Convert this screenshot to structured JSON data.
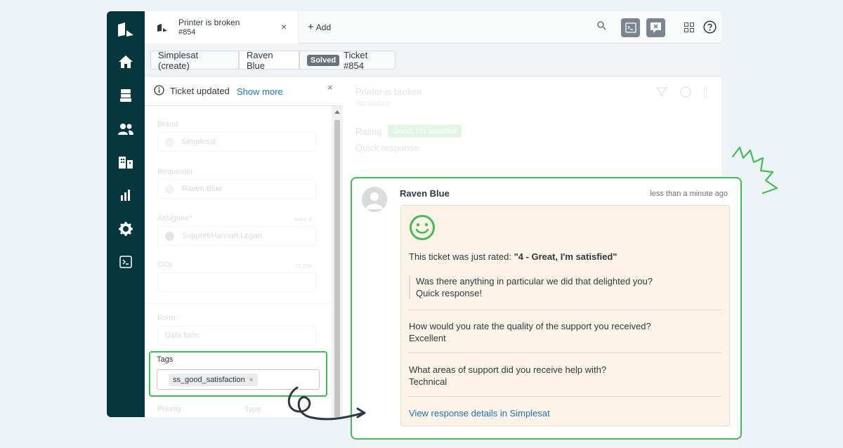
{
  "colors": {
    "nav_bg": "#03363d",
    "highlight_green": "#44bb55",
    "link_blue": "#1f73b7",
    "card_bg": "#fdf3e6",
    "solved_badge": "#68737d"
  },
  "nav": {
    "items": [
      "logo-icon",
      "home-icon",
      "views-icon",
      "customers-icon",
      "organizations-icon",
      "reporting-icon",
      "admin-gear-icon",
      "console-icon"
    ]
  },
  "topbar": {
    "tab_title": "Printer is broken",
    "tab_sub": "#854",
    "tab_close": "×",
    "add_plus": "+",
    "add_label": "Add"
  },
  "subbar": {
    "crumb1": "Simplesat (create)",
    "crumb2": "Raven Blue",
    "status_badge": "Solved",
    "ticket_label": "Ticket #854"
  },
  "notice": {
    "text": "Ticket updated",
    "link": "Show more",
    "close": "×"
  },
  "fields": {
    "brand_label": "Brand",
    "brand_value": "Simplesat",
    "requester_label": "Requester",
    "requester_value": "Raven Blue",
    "assignee_label": "Assignee*",
    "assignee_action": "take it",
    "assignee_value": "Support/Hannah Logan",
    "ccs_label": "CCs",
    "ccs_action": "cc me",
    "form_label": "Form",
    "form_value": "Data form",
    "priority_label": "Priority",
    "type_label": "Type"
  },
  "tags": {
    "label": "Tags",
    "chip": "ss_good_satisfaction",
    "chip_remove": "×"
  },
  "convo_bg": {
    "title": "Printer is broken",
    "sub": "Via Update",
    "rating_label": "Rating",
    "rating_value": "Good, I'm satisfied",
    "quick": "Quick response"
  },
  "comment": {
    "author": "Raven Blue",
    "time": "less than a minute ago",
    "rated_prefix": "This ticket was just rated: ",
    "rated_value": "\"4 - Great, I'm satisfied\"",
    "q1": "Was there anything in particular we did that delighted you?",
    "a1": "Quick response!",
    "q2": "How would you rate the quality of the support you received?",
    "a2": "Excellent",
    "q3": "What areas of support did you receive help with?",
    "a3": "Technical",
    "link": "View response details in Simplesat"
  }
}
